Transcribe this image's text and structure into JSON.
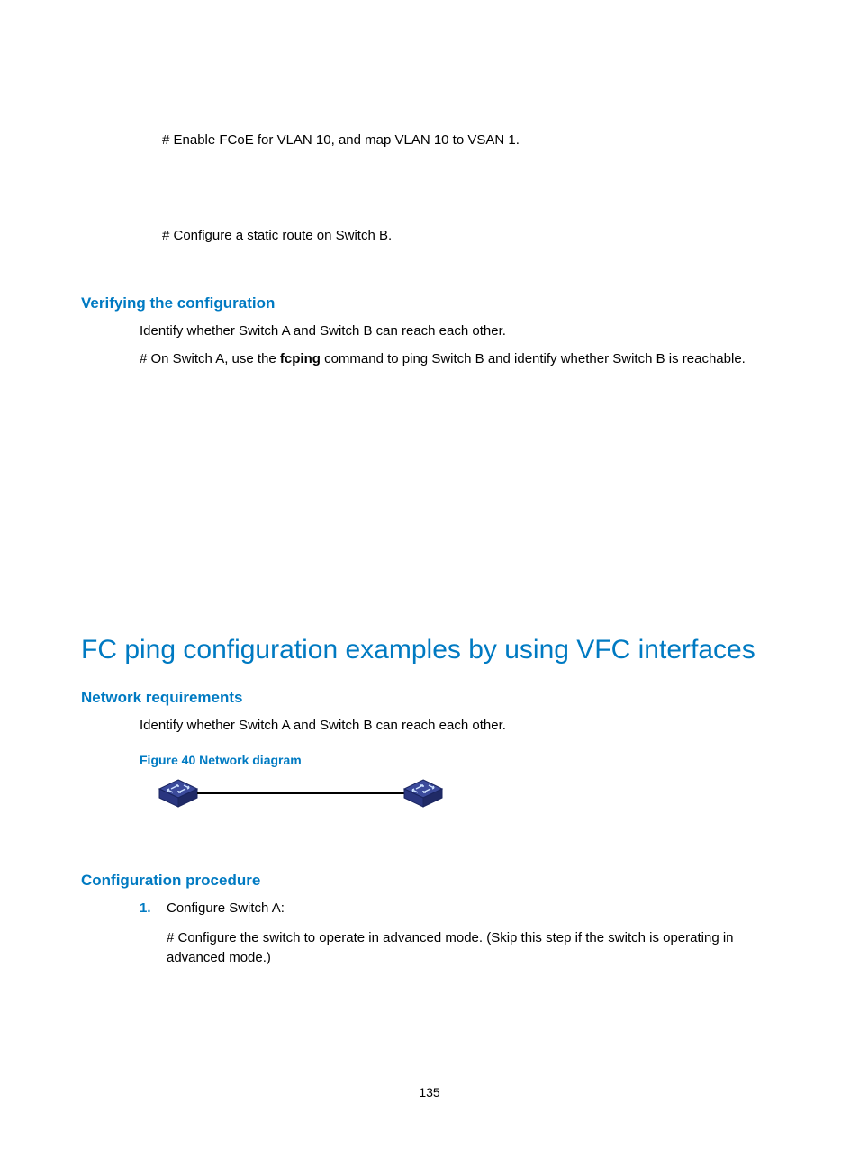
{
  "line1": "# Enable FCoE for VLAN 10, and map VLAN 10 to VSAN 1.",
  "line2": "# Configure a static route on Switch B.",
  "subheading1": "Verifying the configuration",
  "verify_line1": "Identify whether Switch A and Switch B can reach each other.",
  "verify_line2_a": "# On Switch A, use the ",
  "verify_line2_bold": "fcping",
  "verify_line2_b": " command to ping Switch B and identify whether Switch B is reachable.",
  "h1": "FC ping configuration examples by using VFC interfaces",
  "subheading2": "Network requirements",
  "netreq_line1": "Identify whether Switch A and Switch B can reach each other.",
  "figure_caption": "Figure 40 Network diagram",
  "subheading3": "Configuration procedure",
  "step1_num": "1.",
  "step1_text": "Configure Switch A:",
  "step1_sub": "# Configure the switch to operate in advanced mode. (Skip this step if the switch is operating in advanced mode.)",
  "page_num": "135"
}
